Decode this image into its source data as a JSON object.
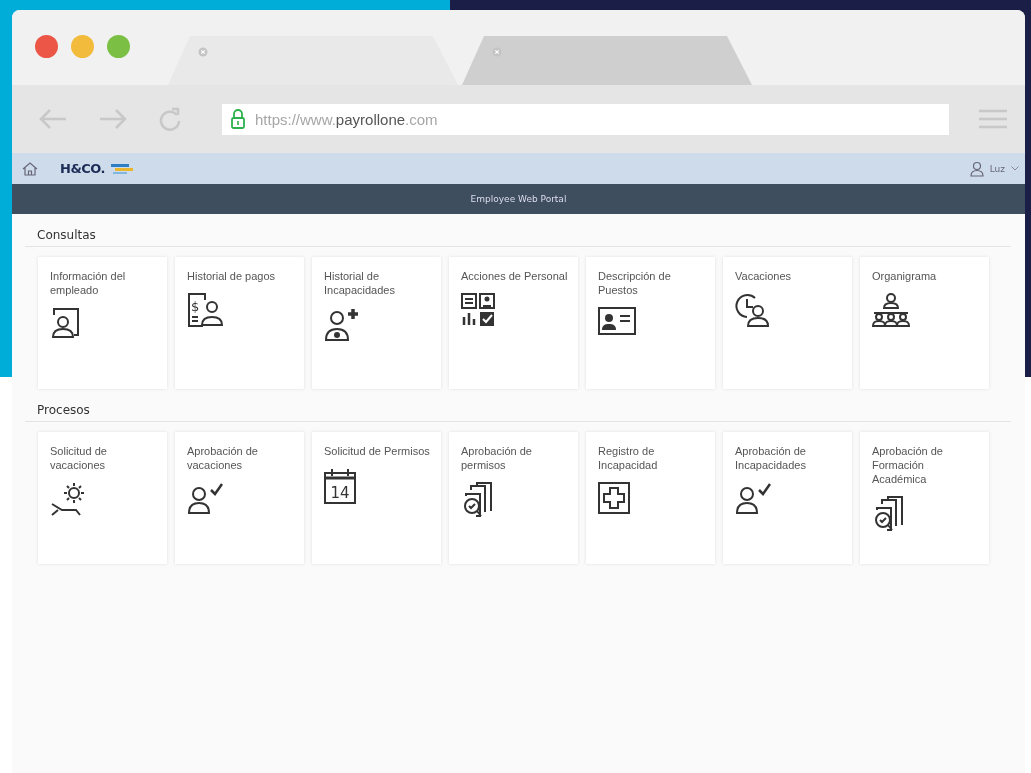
{
  "browser": {
    "tabs": [
      {
        "selected": true
      },
      {
        "selected": false
      }
    ],
    "url": "https://www.**payrollone**.com"
  },
  "app": {
    "logo": "H&CO.",
    "user": "Luz",
    "banner": "Employee Web Portal"
  },
  "sections": [
    {
      "title": "Consultas",
      "tiles": [
        {
          "label": "Información del empleado",
          "kind": "frame"
        },
        {
          "label": "Historial de pagos",
          "kind": "pay",
          "icon_text": "$"
        },
        {
          "label": "Historial de Incapacidades",
          "kind": "plus"
        },
        {
          "label": "Acciones de Personal",
          "kind": "grid"
        },
        {
          "label": "Descripción de Puestos",
          "kind": "card"
        },
        {
          "label": "Vacaciones",
          "kind": "clock"
        },
        {
          "label": "Organigrama",
          "kind": "org"
        }
      ]
    },
    {
      "title": "Procesos",
      "tiles": [
        {
          "label": "Solicitud de vacaciones",
          "kind": "sun"
        },
        {
          "label": "Aprobación de vacaciones",
          "kind": "check"
        },
        {
          "label": "Solicitud de Permisos",
          "kind": "calendar",
          "icon_text": "14"
        },
        {
          "label": "Aprobación de permisos",
          "kind": "search"
        },
        {
          "label": "Registro de Incapacidad",
          "kind": "cross"
        },
        {
          "label": "Aprobación de Incapacidades",
          "kind": "check"
        },
        {
          "label": "Aprobación de Formación Académica",
          "kind": "search"
        }
      ]
    }
  ]
}
